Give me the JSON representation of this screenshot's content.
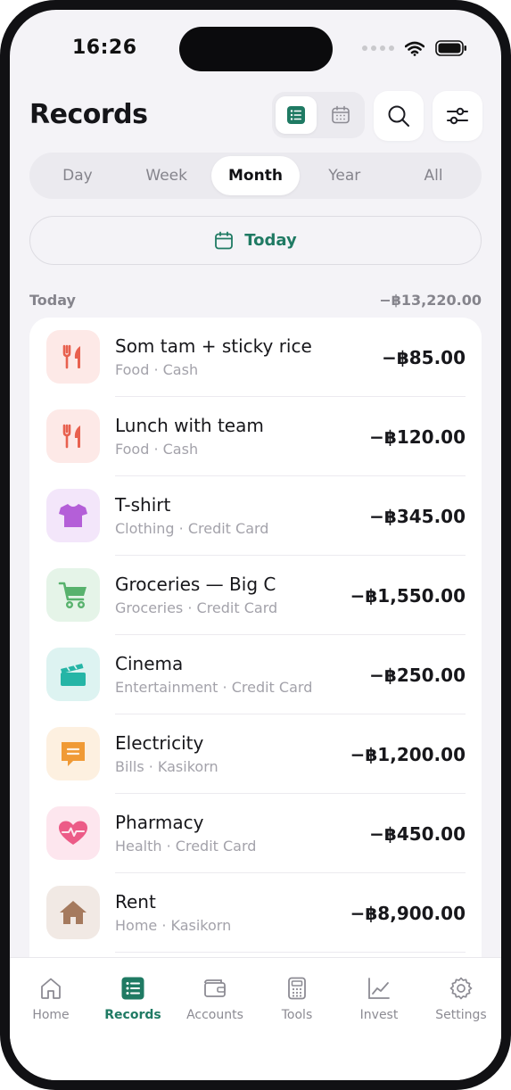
{
  "status_bar": {
    "time": "16:26"
  },
  "header": {
    "title": "Records"
  },
  "period_tabs": [
    {
      "label": "Day",
      "active": false
    },
    {
      "label": "Week",
      "active": false
    },
    {
      "label": "Month",
      "active": true
    },
    {
      "label": "Year",
      "active": false
    },
    {
      "label": "All",
      "active": false
    }
  ],
  "today_button": {
    "label": "Today"
  },
  "section": {
    "label": "Today",
    "total": "−฿13,220.00"
  },
  "records": [
    {
      "title": "Som tam + sticky rice",
      "subtitle": "Food · Cash",
      "amount": "−฿85.00",
      "icon": "fork-knife-icon",
      "color": "#e8614f",
      "bg": "#fde9e7"
    },
    {
      "title": "Lunch with team",
      "subtitle": "Food · Cash",
      "amount": "−฿120.00",
      "icon": "fork-knife-icon",
      "color": "#e8614f",
      "bg": "#fde9e7"
    },
    {
      "title": "T-shirt",
      "subtitle": "Clothing · Credit Card",
      "amount": "−฿345.00",
      "icon": "tshirt-icon",
      "color": "#b45fd8",
      "bg": "#f3e6fa"
    },
    {
      "title": "Groceries — Big C",
      "subtitle": "Groceries · Credit Card",
      "amount": "−฿1,550.00",
      "icon": "cart-icon",
      "color": "#58b26d",
      "bg": "#e5f4e8"
    },
    {
      "title": "Cinema",
      "subtitle": "Entertainment · Credit Card",
      "amount": "−฿250.00",
      "icon": "clapperboard-icon",
      "color": "#25b5a6",
      "bg": "#ddf3f1"
    },
    {
      "title": "Electricity",
      "subtitle": "Bills · Kasikorn",
      "amount": "−฿1,200.00",
      "icon": "receipt-icon",
      "color": "#f09a35",
      "bg": "#fdf0e0"
    },
    {
      "title": "Pharmacy",
      "subtitle": "Health · Credit Card",
      "amount": "−฿450.00",
      "icon": "heart-pulse-icon",
      "color": "#ec5b87",
      "bg": "#fde6ee"
    },
    {
      "title": "Rent",
      "subtitle": "Home · Kasikorn",
      "amount": "−฿8,900.00",
      "icon": "house-icon",
      "color": "#a57a5e",
      "bg": "#f1e9e4"
    }
  ],
  "tabbar": [
    {
      "label": "Home",
      "icon": "home-icon",
      "active": false
    },
    {
      "label": "Records",
      "icon": "records-icon",
      "active": true
    },
    {
      "label": "Accounts",
      "icon": "wallet-icon",
      "active": false
    },
    {
      "label": "Tools",
      "icon": "calculator-icon",
      "active": false
    },
    {
      "label": "Invest",
      "icon": "chart-icon",
      "active": false
    },
    {
      "label": "Settings",
      "icon": "gear-icon",
      "active": false
    }
  ],
  "colors": {
    "accent": "#1f7a63",
    "background": "#f4f3f7",
    "muted": "#85848c"
  }
}
